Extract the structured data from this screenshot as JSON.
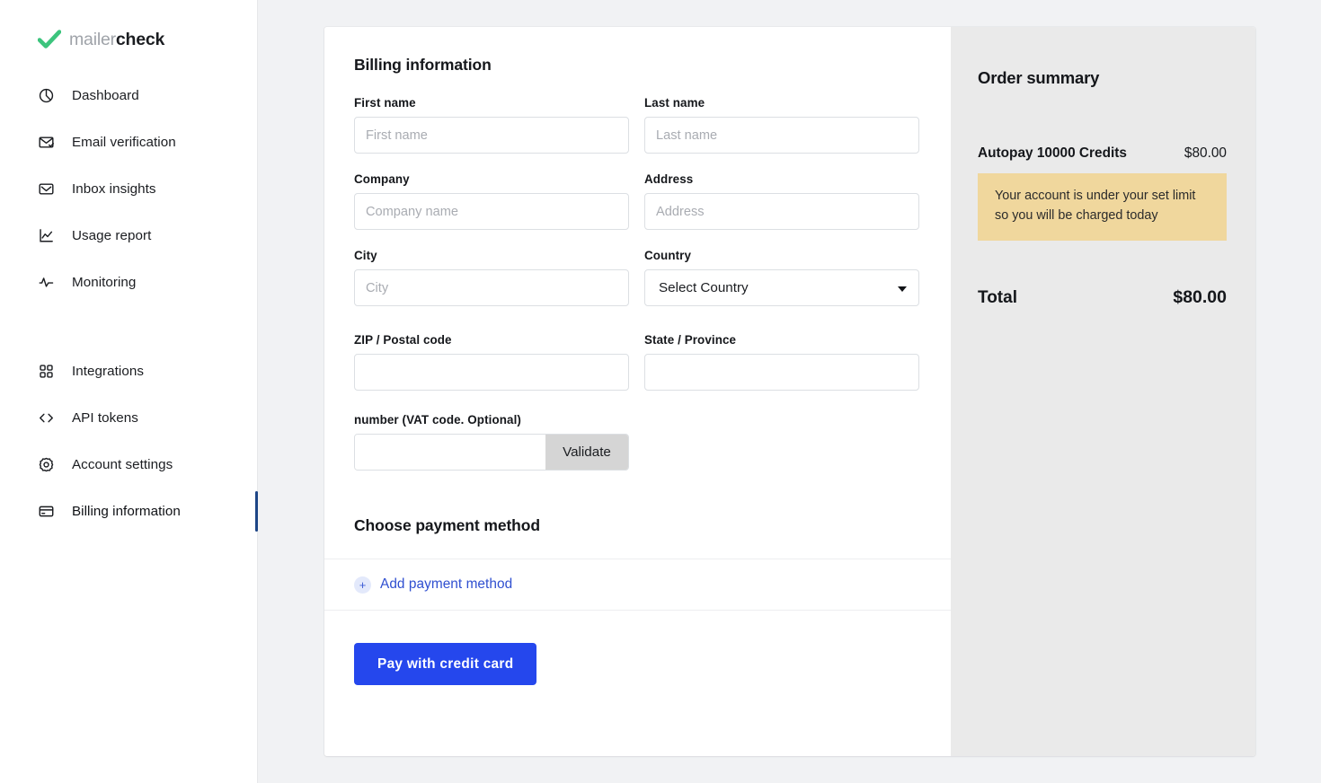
{
  "brand": {
    "name_light": "mailer",
    "name_bold": "check",
    "check_color": "#3cc47d",
    "logo_light_color": "#9fa3a9"
  },
  "sidebar": {
    "group_one": [
      {
        "label": "Dashboard",
        "icon": "pie-chart-icon",
        "active": false
      },
      {
        "label": "Email verification",
        "icon": "mail-check-icon",
        "active": false
      },
      {
        "label": "Inbox insights",
        "icon": "inbox-icon",
        "active": false
      },
      {
        "label": "Usage report",
        "icon": "line-chart-icon",
        "active": false
      },
      {
        "label": "Monitoring",
        "icon": "activity-pulse-icon",
        "active": false
      }
    ],
    "group_two": [
      {
        "label": "Integrations",
        "icon": "grid-dots-icon",
        "active": false
      },
      {
        "label": "API tokens",
        "icon": "code-brackets-icon",
        "active": false
      },
      {
        "label": "Account settings",
        "icon": "gear-icon",
        "active": false
      },
      {
        "label": "Billing information",
        "icon": "credit-card-icon",
        "active": true
      }
    ],
    "active_indicator_color": "#1d4586"
  },
  "billing": {
    "title": "Billing information",
    "fields": {
      "first_name": {
        "label": "First name",
        "placeholder": "First name",
        "value": ""
      },
      "last_name": {
        "label": "Last name",
        "placeholder": "Last name",
        "value": ""
      },
      "company": {
        "label": "Company",
        "placeholder": "Company name",
        "value": ""
      },
      "address": {
        "label": "Address",
        "placeholder": "Address",
        "value": ""
      },
      "city": {
        "label": "City",
        "placeholder": "City",
        "value": ""
      },
      "country": {
        "label": "Country",
        "selected": "Select Country"
      },
      "zip": {
        "label": "ZIP / Postal code",
        "placeholder": "",
        "value": ""
      },
      "state": {
        "label": "State / Province",
        "placeholder": "",
        "value": ""
      },
      "vat": {
        "label": "number (VAT code. Optional)",
        "placeholder": "",
        "value": "",
        "button": "Validate"
      }
    },
    "country_options": [
      "Select Country"
    ]
  },
  "payment": {
    "title": "Choose payment method",
    "add_method_label": "Add payment method",
    "add_method_icon": "plus-icon",
    "pay_button": "Pay with credit card",
    "pay_button_color": "#2547ed",
    "link_color": "#2f4fd0"
  },
  "order_summary": {
    "title": "Order summary",
    "items": [
      {
        "name": "Autopay 10000 Credits",
        "price": "$80.00"
      }
    ],
    "notice": "Your account is under your set limit so you will be charged today",
    "notice_color": "#f0d79d",
    "total_label": "Total",
    "total_value": "$80.00",
    "panel_color": "#eaeaea"
  }
}
